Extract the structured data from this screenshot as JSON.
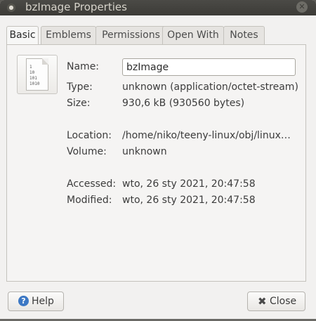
{
  "window": {
    "title": "bzImage Properties"
  },
  "tabs": [
    {
      "label": "Basic"
    },
    {
      "label": "Emblems"
    },
    {
      "label": "Permissions"
    },
    {
      "label": "Open With"
    },
    {
      "label": "Notes"
    }
  ],
  "file": {
    "icon": "binary-file-icon",
    "icon_text": [
      "1",
      "10",
      "101",
      "1010"
    ]
  },
  "fields": {
    "name_label": "Name:",
    "name_value": "bzImage",
    "type_label": "Type:",
    "type_value": "unknown (application/octet-stream)",
    "size_label": "Size:",
    "size_value": "930,6 kB (930560 bytes)",
    "location_label": "Location:",
    "location_value": "/home/niko/teeny-linux/obj/linux…",
    "volume_label": "Volume:",
    "volume_value": "unknown",
    "accessed_label": "Accessed:",
    "accessed_value": "wto, 26 sty 2021, 20:47:58",
    "modified_label": "Modified:",
    "modified_value": "wto, 26 sty 2021, 20:47:58"
  },
  "buttons": {
    "help_label": "Help",
    "close_label": "Close"
  }
}
